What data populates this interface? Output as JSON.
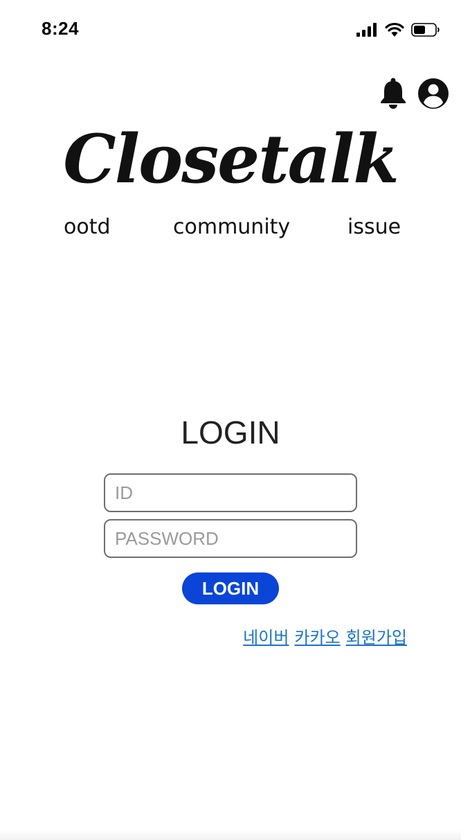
{
  "status_bar": {
    "time": "8:24",
    "icons": [
      "signal-icon",
      "wifi-icon",
      "battery-icon"
    ]
  },
  "header": {
    "icons": [
      "bell-icon",
      "account-icon"
    ],
    "logo": "Closetalk"
  },
  "nav": {
    "items": [
      {
        "label": "ootd"
      },
      {
        "label": "community"
      },
      {
        "label": "issue"
      }
    ]
  },
  "login": {
    "title": "LOGIN",
    "id_placeholder": "ID",
    "id_value": "",
    "password_placeholder": "PASSWORD",
    "password_value": "",
    "button_label": "LOGIN",
    "links": {
      "naver": "네이버",
      "kakao": "카카오",
      "signup": "회원가입"
    }
  },
  "colors": {
    "button": "#0a45d8",
    "link": "#1a73c9",
    "text": "#111111"
  }
}
